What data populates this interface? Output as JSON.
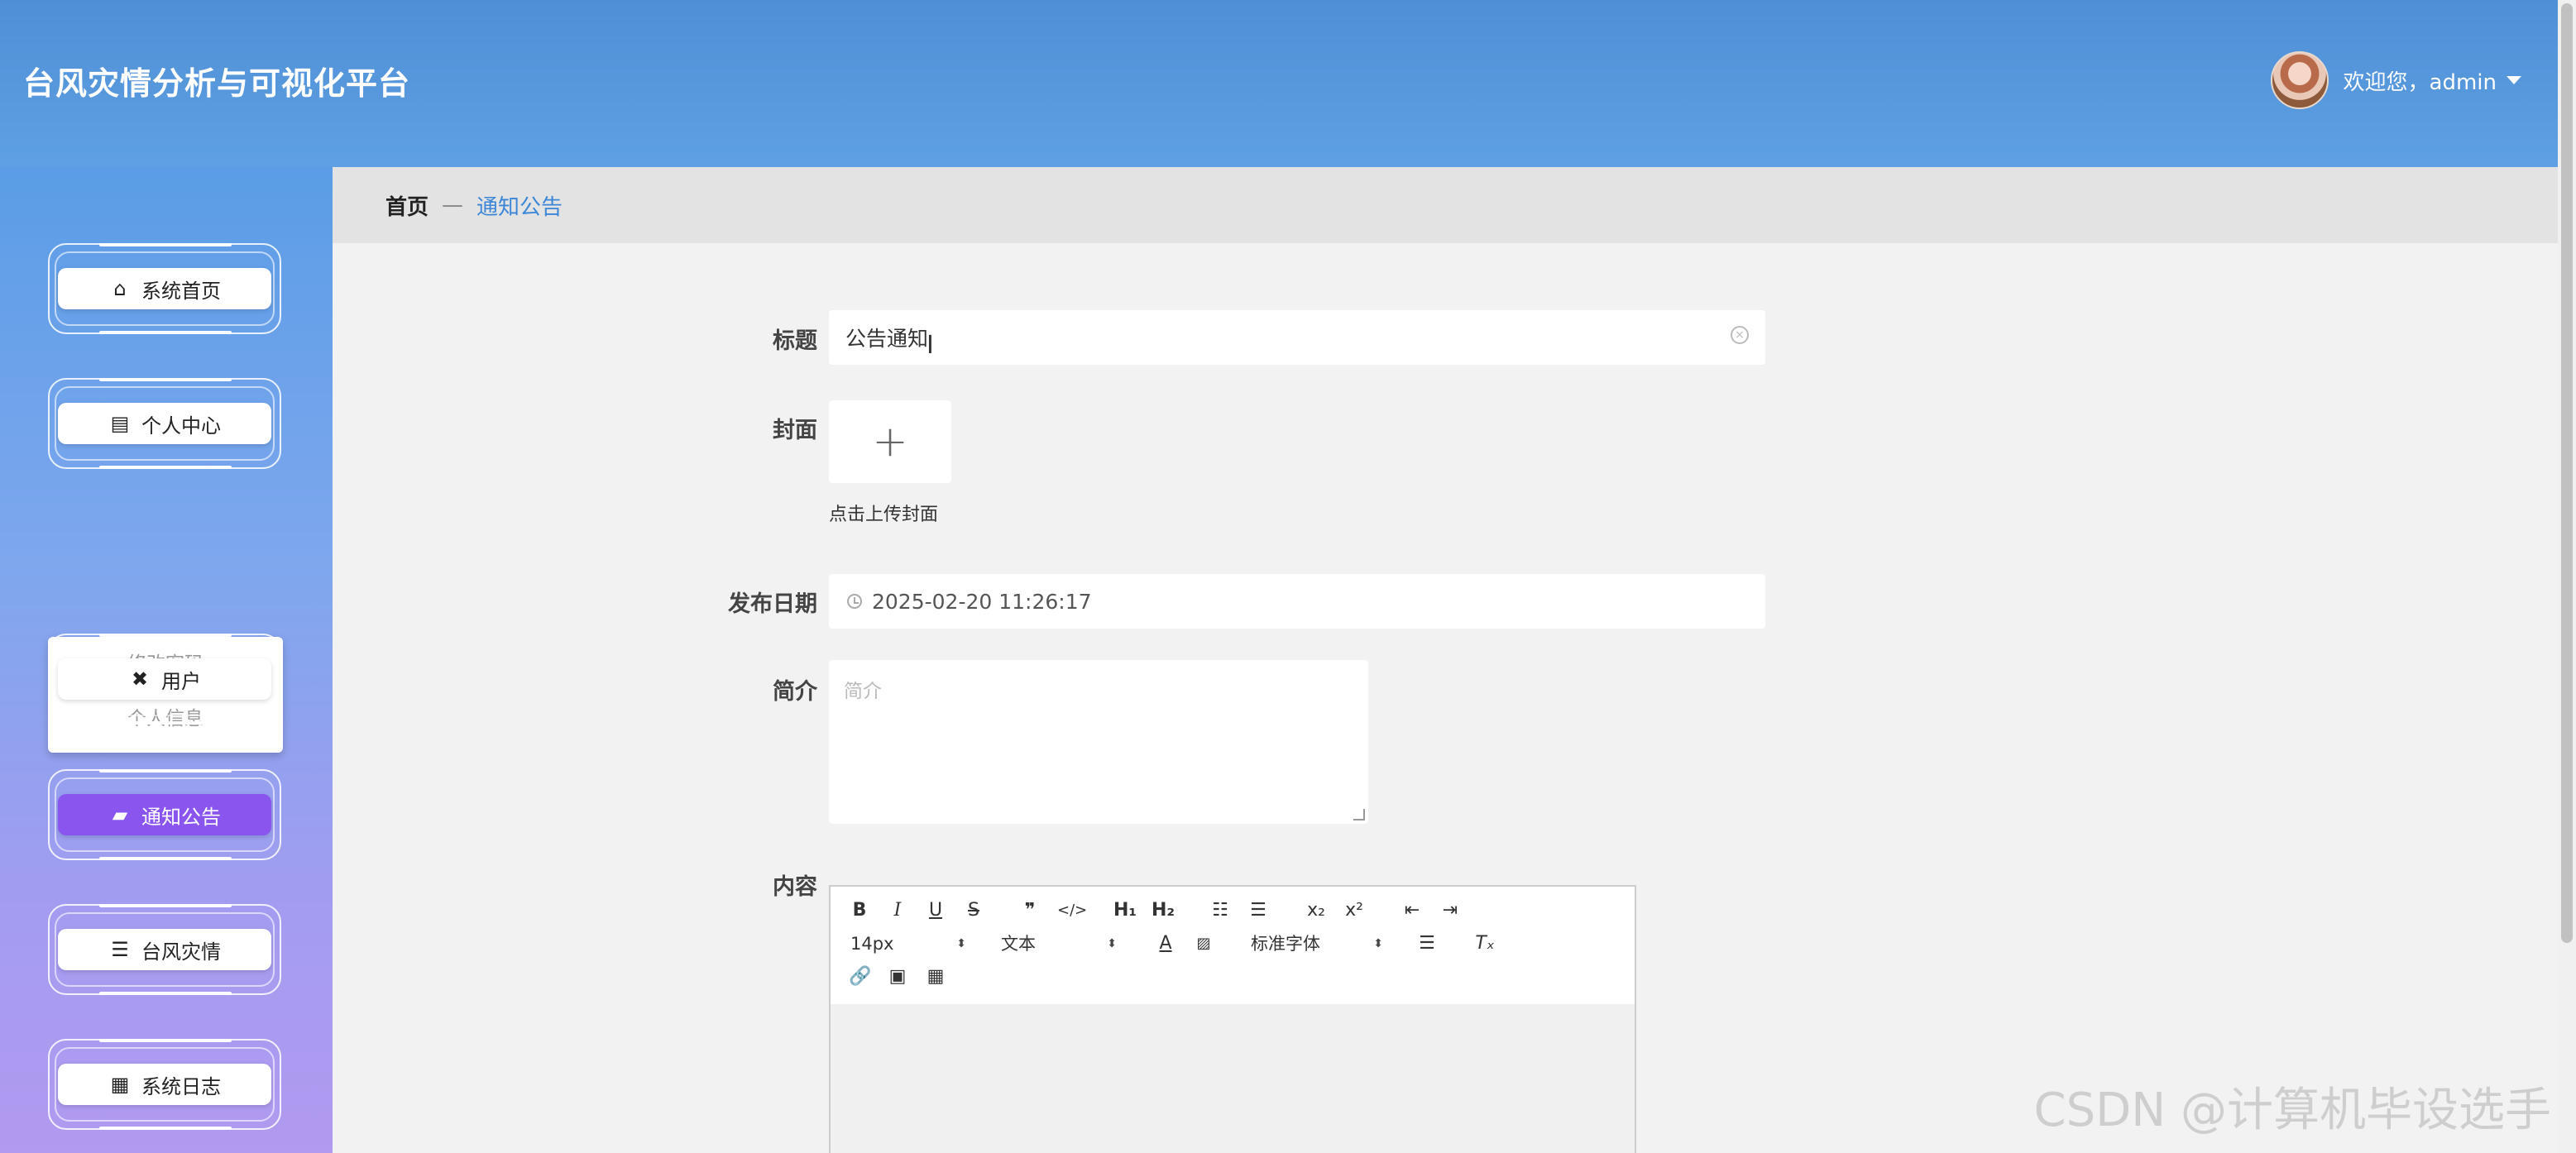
{
  "header": {
    "title": "台风灾情分析与可视化平台",
    "welcome": "欢迎您，admin"
  },
  "sidebar": {
    "items": [
      {
        "label": "系统首页",
        "icon": "home-icon"
      },
      {
        "label": "个人中心",
        "icon": "card-icon"
      },
      {
        "label": "用户",
        "icon": "ticket-icon"
      },
      {
        "label": "通知公告",
        "icon": "briefcase-icon"
      },
      {
        "label": "台风灾情",
        "icon": "list-icon"
      },
      {
        "label": "系统日志",
        "icon": "grid-icon"
      }
    ],
    "submenu": [
      "修改密码",
      "个人信息"
    ],
    "active_color": "#8a54ee"
  },
  "breadcrumb": {
    "home": "首页",
    "sep": "—",
    "current": "通知公告"
  },
  "form": {
    "title_label": "标题",
    "title_value": "公告通知",
    "cover_label": "封面",
    "cover_hint": "点击上传封面",
    "date_label": "发布日期",
    "date_value": "2025-02-20 11:26:17",
    "intro_label": "简介",
    "intro_placeholder": "简介",
    "content_label": "内容"
  },
  "editor": {
    "font_size": "14px",
    "paragraph": "文本",
    "font_family": "标准字体"
  },
  "watermark": "CSDN @计算机毕设选手"
}
